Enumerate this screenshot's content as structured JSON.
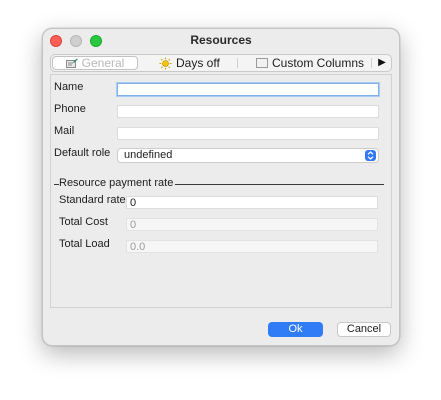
{
  "window": {
    "title": "Resources"
  },
  "tabs": [
    {
      "label": "General",
      "icon": "edit-card-icon"
    },
    {
      "label": "Days off",
      "icon": "sun-icon"
    },
    {
      "label": "Custom Columns",
      "icon": "table-icon"
    }
  ],
  "tab_overflow_arrow": "▶",
  "form": {
    "name_label": "Name",
    "name_value": "",
    "phone_label": "Phone",
    "phone_value": "",
    "mail_label": "Mail",
    "mail_value": "",
    "role_label": "Default role",
    "role_value": "undefined"
  },
  "payment": {
    "group_title": "Resource payment rate",
    "standard_rate_label": "Standard rate",
    "standard_rate_value": "0",
    "total_cost_label": "Total Cost",
    "total_cost_value": "0",
    "total_load_label": "Total Load",
    "total_load_value": "0.0"
  },
  "buttons": {
    "ok": "Ok",
    "cancel": "Cancel"
  },
  "colors": {
    "accent": "#2f7cf6",
    "close": "#ff5f57",
    "zoom": "#28c840"
  }
}
